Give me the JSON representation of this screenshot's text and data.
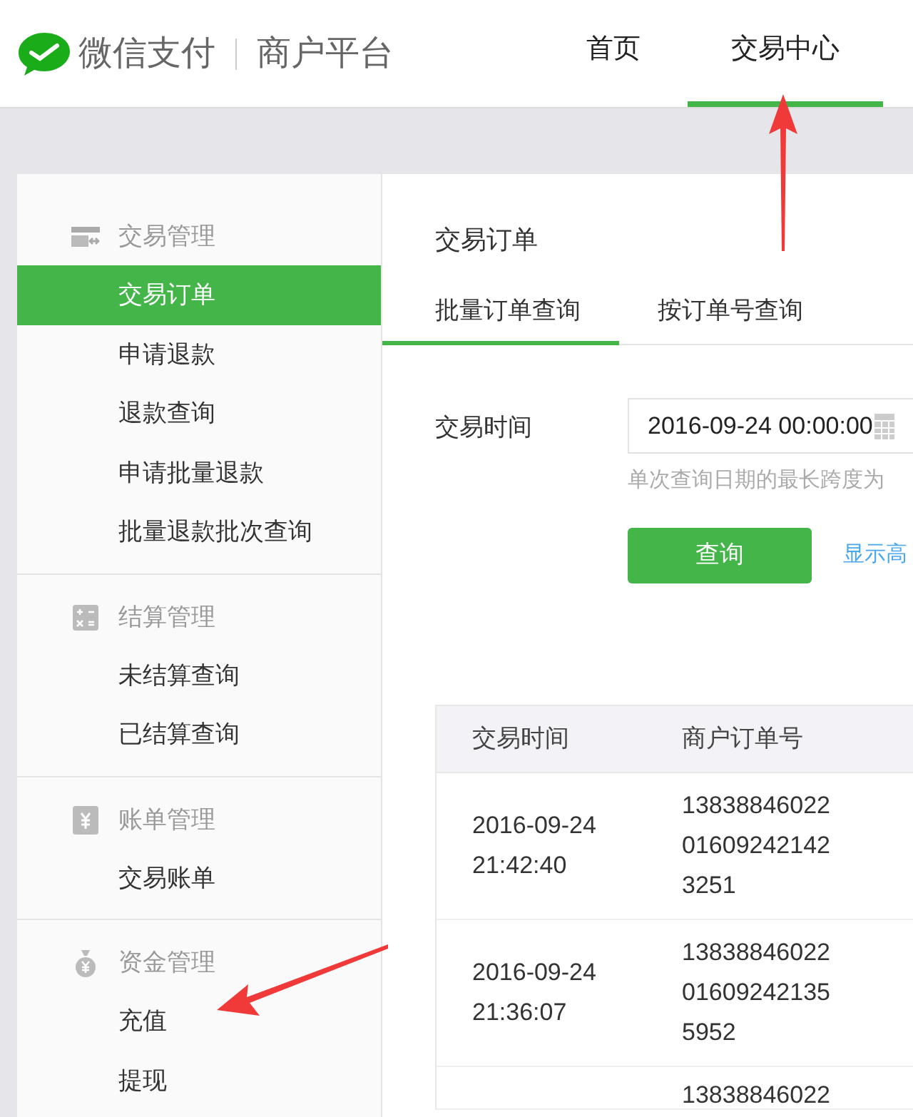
{
  "header": {
    "brand": "微信支付",
    "platform": "商户平台",
    "nav": [
      {
        "label": "首页",
        "selected": false
      },
      {
        "label": "交易中心",
        "selected": true
      }
    ]
  },
  "sidebar": {
    "groups": [
      {
        "title": "交易管理",
        "kind": "card",
        "items": [
          {
            "label": "交易订单",
            "selected": true
          },
          {
            "label": "申请退款",
            "selected": false
          },
          {
            "label": "退款查询",
            "selected": false
          },
          {
            "label": "申请批量退款",
            "selected": false
          },
          {
            "label": "批量退款批次查询",
            "selected": false
          }
        ]
      },
      {
        "title": "结算管理",
        "kind": "calculator",
        "items": [
          {
            "label": "未结算查询",
            "selected": false
          },
          {
            "label": "已结算查询",
            "selected": false
          }
        ]
      },
      {
        "title": "账单管理",
        "kind": "bill",
        "items": [
          {
            "label": "交易账单",
            "selected": false
          }
        ]
      },
      {
        "title": "资金管理",
        "kind": "moneybag",
        "items": [
          {
            "label": "充值",
            "selected": false
          },
          {
            "label": "提现",
            "selected": false
          }
        ]
      }
    ]
  },
  "main": {
    "title": "交易订单",
    "tabs": [
      {
        "label": "批量订单查询",
        "selected": true
      },
      {
        "label": "按订单号查询",
        "selected": false
      }
    ],
    "filter": {
      "label": "交易时间",
      "value": "2016-09-24 00:00:00",
      "hint": "单次查询日期的最长跨度为",
      "button": "查询",
      "link": "显示高"
    },
    "table": {
      "columns": [
        "交易时间",
        "商户订单号"
      ],
      "rows": [
        {
          "time": "2016-09-24\n21:42:40",
          "order": "13838846022\n01609242142\n3251"
        },
        {
          "time": "2016-09-24\n21:36:07",
          "order": "13838846022\n01609242135\n5952"
        },
        {
          "order": "13838846022"
        }
      ]
    }
  }
}
